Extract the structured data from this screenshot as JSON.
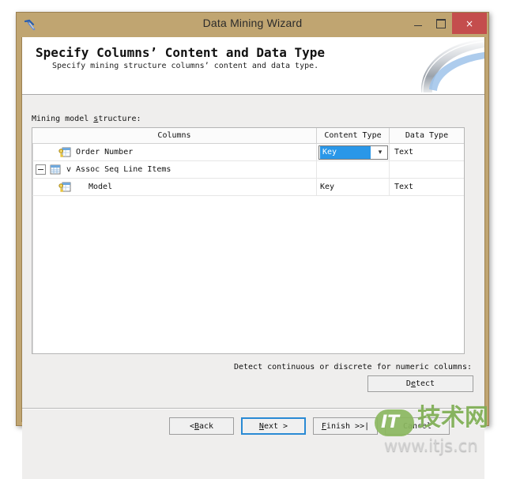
{
  "window": {
    "title": "Data Mining Wizard",
    "icon": "pickaxe-icon",
    "minimize_label": "Minimize",
    "maximize_label": "Maximize",
    "close_label": "×"
  },
  "banner": {
    "heading": "Specify Columns’ Content and Data Type",
    "subheading": "Specify mining structure columns’ content and data type."
  },
  "panel": {
    "structure_label": "Mining model structure:"
  },
  "grid": {
    "headers": {
      "columns": "Columns",
      "content_type": "Content Type",
      "data_type": "Data Type"
    },
    "rows": [
      {
        "name": "Order Number",
        "icon": "key-table-icon",
        "indent": 1,
        "expander": "none",
        "content_type": "Key",
        "content_type_editing": true,
        "data_type": "Text"
      },
      {
        "name": "v Assoc Seq Line Items",
        "icon": "table-icon",
        "indent": 0,
        "expander": "collapse",
        "content_type": "",
        "content_type_editing": false,
        "data_type": ""
      },
      {
        "name": "Model",
        "icon": "key-table-icon",
        "indent": 2,
        "expander": "none",
        "content_type": "Key",
        "content_type_editing": false,
        "data_type": "Text"
      }
    ],
    "dropdown_arrow": "▾"
  },
  "detect": {
    "hint": "Detect continuous or discrete for numeric columns:",
    "button_label": "Detect"
  },
  "footer": {
    "buttons": [
      {
        "label": "< Back",
        "focused": false
      },
      {
        "label": "Next >",
        "focused": true
      },
      {
        "label": "Finish >>|",
        "focused": false
      },
      {
        "label": "Cancel",
        "focused": false
      }
    ]
  },
  "watermark": {
    "badge": "IT",
    "brand": "技术网",
    "url": "www.itjs.cn"
  },
  "colors": {
    "titlebar": "#c0a571",
    "close_button": "#c44d4d",
    "selection_blue": "#2a97e8",
    "focus_border": "#2a8ad4",
    "client_bg": "#efeeed",
    "watermark_green": "#7fae54"
  }
}
